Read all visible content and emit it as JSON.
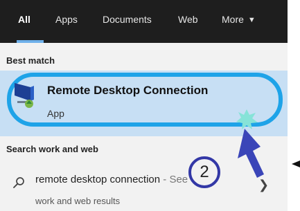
{
  "tabs": [
    {
      "label": "All"
    },
    {
      "label": "Apps"
    },
    {
      "label": "Documents"
    },
    {
      "label": "Web"
    },
    {
      "label": "More"
    }
  ],
  "sections": {
    "best_match": "Best match",
    "search_work_web": "Search work and web"
  },
  "best_match": {
    "title": "Remote Desktop Connection",
    "type": "App"
  },
  "web_result": {
    "query": "remote desktop connection",
    "suffix": " - See",
    "subtitle": "work and web results"
  },
  "annotation": {
    "step_number": "2"
  },
  "colors": {
    "tabbar_bg": "#1e1e1e",
    "tab_underline": "#6fb0ea",
    "selection_bg": "#c7dff4",
    "highlight_ring": "#1ea3e8",
    "arrow": "#3a45b8"
  },
  "icons": {
    "app": "remote-desktop-icon",
    "search": "search-icon",
    "chevron": "chevron-right-icon",
    "dropdown": "caret-down-icon"
  }
}
